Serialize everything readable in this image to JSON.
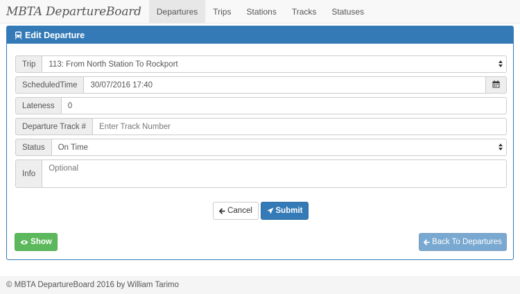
{
  "navbar": {
    "brand": "MBTA DepartureBoard",
    "items": [
      {
        "label": "Departures",
        "active": true
      },
      {
        "label": "Trips",
        "active": false
      },
      {
        "label": "Stations",
        "active": false
      },
      {
        "label": "Tracks",
        "active": false
      },
      {
        "label": "Statuses",
        "active": false
      }
    ]
  },
  "panel": {
    "title": "Edit Departure",
    "title_icon": "train-icon"
  },
  "form": {
    "trip": {
      "label": "Trip",
      "value": "113: From North Station To Rockport"
    },
    "scheduled_time": {
      "label": "ScheduledTime",
      "value": "30/07/2016 17:40",
      "icon": "calendar-icon"
    },
    "lateness": {
      "label": "Lateness",
      "value": "0"
    },
    "track": {
      "label": "Departure Track #",
      "placeholder": "Enter Track Number",
      "value": ""
    },
    "status": {
      "label": "Status",
      "value": "On Time"
    },
    "info": {
      "label": "Info",
      "placeholder": "Optional",
      "value": ""
    }
  },
  "buttons": {
    "cancel": "Cancel",
    "submit": "Submit",
    "show": "Show",
    "back": "Back To Departures"
  },
  "footer": {
    "text": "© MBTA DepartureBoard 2016 by William Tarimo"
  },
  "colors": {
    "primary": "#337ab7",
    "success": "#5cb85c",
    "navbar_bg": "#f8f8f8",
    "footer_bg": "#f5f5f5"
  }
}
